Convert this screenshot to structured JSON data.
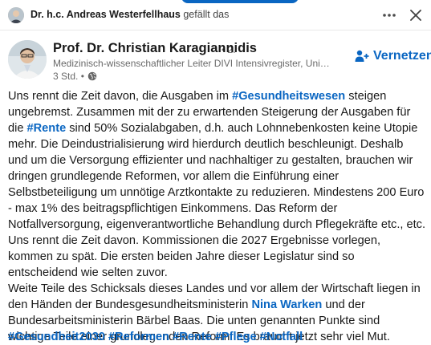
{
  "activity": {
    "actor": "Dr. h.c. Andreas Westerfellhaus",
    "action": "gefällt das"
  },
  "author": {
    "name": "Prof. Dr. Christian Karagiannidis",
    "degree": "• 2.",
    "headline": "Medizinisch-wissenschaftlicher Leiter DIVI Intensivregister, Universi...",
    "time": "3 Std. •",
    "time_icon": "globe-icon",
    "connect_label": "Vernetzen"
  },
  "post": {
    "segments": [
      {
        "text": "Uns rennt die Zeit davon, die Ausgaben im "
      },
      {
        "link": "#Gesundheitswesen"
      },
      {
        "text": " steigen ungebremst. Zusammen mit der zu erwartenden Steigerung der Ausgaben für die "
      },
      {
        "link": "#Rente"
      },
      {
        "text": " sind 50% Sozialabgaben, d.h. auch Lohnnebenkosten keine Utopie mehr. Die Deindustrialisierung wird hierdurch deutlich beschleunigt. Deshalb und um die Versorgung effizienter und nachhaltiger zu gestalten, brauchen wir dringen grundlegende Reformen, vor allem die Einführung einer Selbstbeteiligung um unnötige Arztkontakte zu reduzieren. Mindestens 200 Euro - max 1% des beitragspflichtigen Einkommens. Das Reform der Notfallversorgung, eigenverantwortliche Behandlung durch Pflegekräfte etc., etc. Uns rennt die Zeit davon. Kommissionen die 2027 Ergebnisse vorlegen, kommen zu spät. Die ersten beiden Jahre dieser Legislatur sind so entscheidend wie selten zuvor.\nWeite Teile des Schicksals dieses Landes und vor allem der Wirtschaft liegen in den Händen der Bundesgesundheitsministerin "
      },
      {
        "link": "Nina Warken"
      },
      {
        "text": " und der Bundesarbeitsministerin Bärbel Baas. Die unten genannten Punkte sind wichtige Teile einer grundlegenden Reform. Es braucht jetzt sehr viel Mut."
      }
    ],
    "hashtags": [
      "#Gesundheit2030",
      "#Reformen",
      "#Rente",
      "#Pflege",
      "#Notfall"
    ]
  },
  "colors": {
    "link": "#0a66c2",
    "accent": "#0a66c2"
  }
}
